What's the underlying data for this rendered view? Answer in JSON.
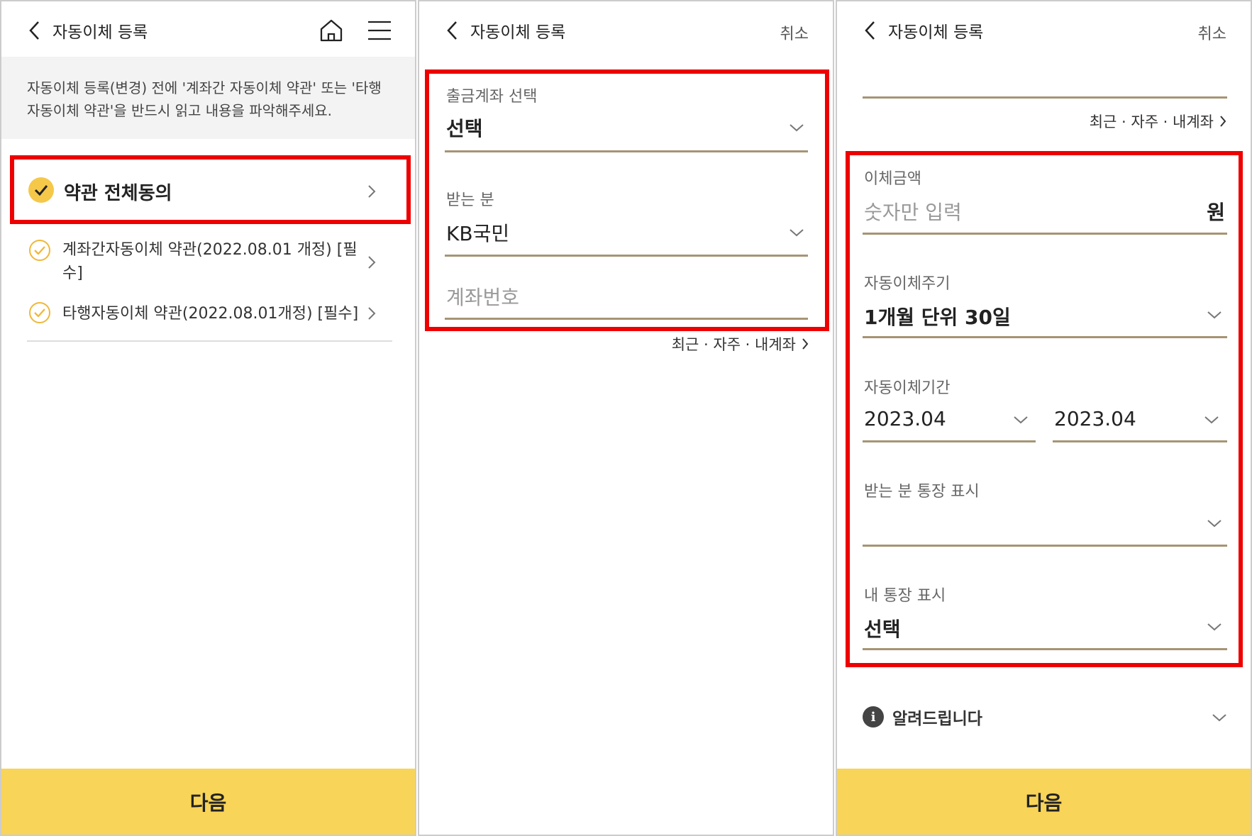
{
  "panel1": {
    "title": "자동이체 등록",
    "notice": "자동이체 등록(변경) 전에 '계좌간 자동이체 약관' 또는 '타행 자동이체 약관'을 반드시 읽고 내용을 파악해주세요.",
    "agree_all": "약관 전체동의",
    "terms": [
      {
        "line1": "계좌간자동이체 약관(2022.08.01 개정) [필",
        "line2": "수]"
      },
      {
        "line1": "타행자동이체 약관(2022.08.01개정) [필수]",
        "line2": ""
      }
    ],
    "next_label": "다음"
  },
  "panel2": {
    "title": "자동이체 등록",
    "cancel": "취소",
    "withdraw_label": "출금계좌 선택",
    "withdraw_value": "선택",
    "receiver_label": "받는 분",
    "receiver_bank": "KB국민",
    "account_placeholder": "계좌번호",
    "recent_link": "최근 · 자주 · 내계좌"
  },
  "panel3": {
    "title": "자동이체 등록",
    "cancel": "취소",
    "recent_link": "최근 · 자주 · 내계좌",
    "amount_label": "이체금액",
    "amount_placeholder": "숫자만 입력",
    "amount_unit": "원",
    "cycle_label": "자동이체주기",
    "cycle_value": "1개월 단위 30일",
    "period_label": "자동이체기간",
    "period_start": "2023.04",
    "period_end": "2023.04",
    "receiver_display_label": "받는 분 통장 표시",
    "receiver_display_value": "",
    "my_display_label": "내 통장 표시",
    "my_display_value": "선택",
    "notice_label": "알려드립니다",
    "next_label": "다음"
  },
  "colors": {
    "accent_yellow": "#f8d458",
    "highlight_red": "#ee0000",
    "underline": "#a69474"
  }
}
